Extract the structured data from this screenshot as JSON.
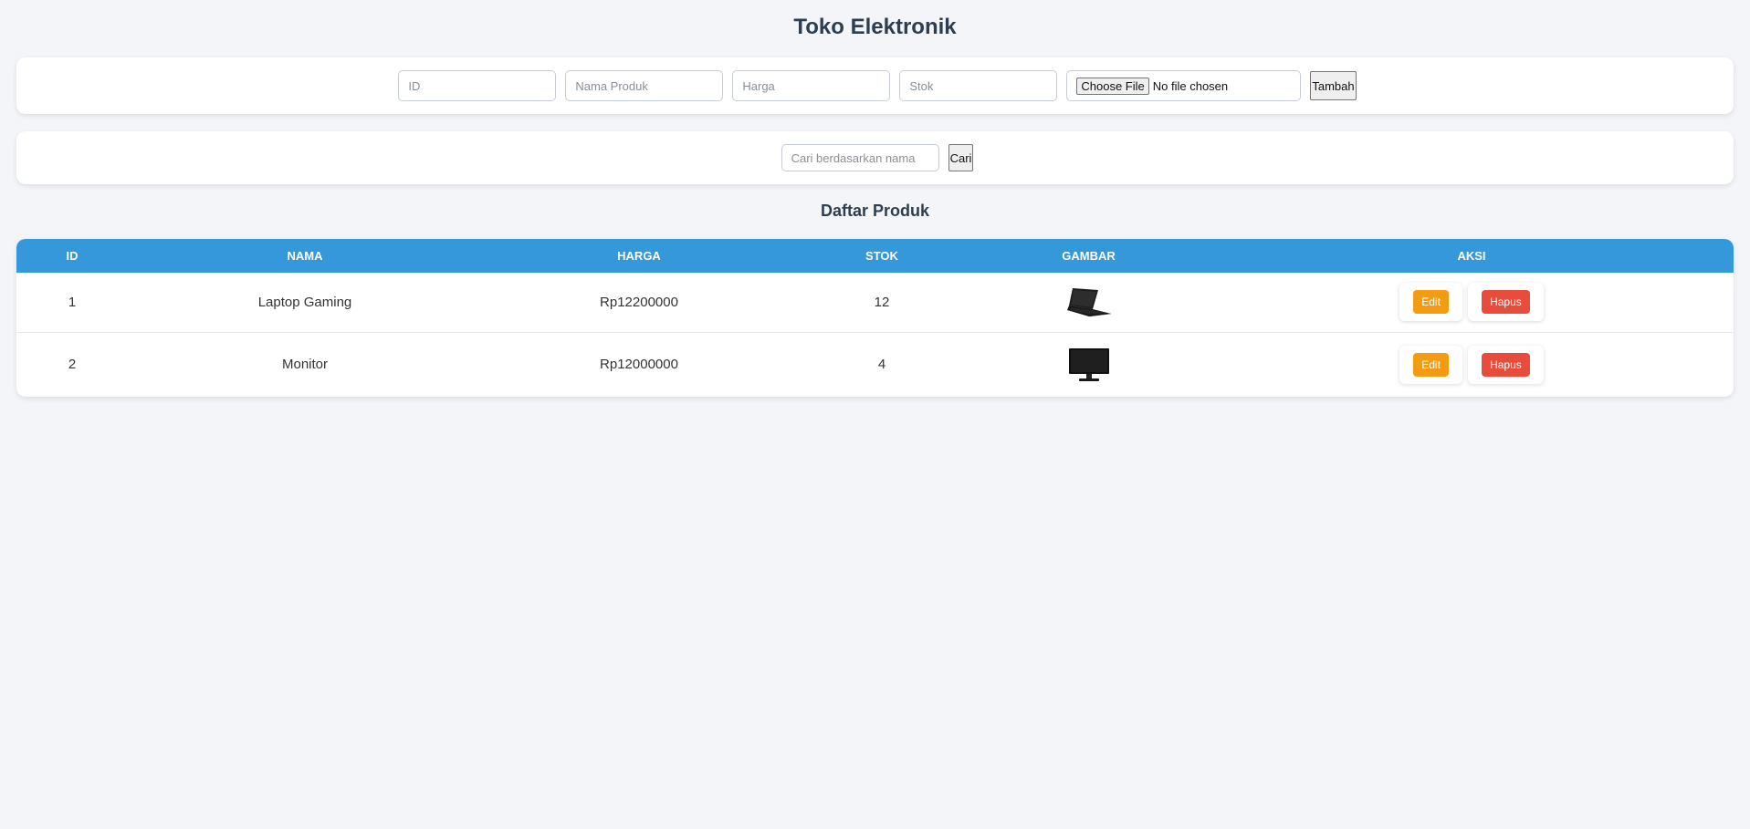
{
  "page": {
    "title": "Toko Elektronik"
  },
  "form": {
    "id_placeholder": "ID",
    "nama_placeholder": "Nama Produk",
    "harga_placeholder": "Harga",
    "stok_placeholder": "Stok",
    "file_button_label": "Choose File",
    "file_status": "No file chosen",
    "submit_label": "Tambah"
  },
  "search": {
    "placeholder": "Cari berdasarkan nama",
    "button_label": "Cari"
  },
  "list": {
    "title": "Daftar Produk",
    "headers": [
      "ID",
      "NAMA",
      "HARGA",
      "STOK",
      "GAMBAR",
      "AKSI"
    ],
    "rows": [
      {
        "id": "1",
        "nama": "Laptop Gaming",
        "harga": "Rp12200000",
        "stok": "12",
        "gambar_icon": "laptop-image",
        "edit_label": "Edit",
        "hapus_label": "Hapus"
      },
      {
        "id": "2",
        "nama": "Monitor",
        "harga": "Rp12000000",
        "stok": "4",
        "gambar_icon": "monitor-image",
        "edit_label": "Edit",
        "hapus_label": "Hapus"
      }
    ]
  },
  "colors": {
    "background": "#f3f5f9",
    "header_blue": "#3498db",
    "edit_orange": "#f39c12",
    "hapus_red": "#e74c3c",
    "title_text": "#2c3e50"
  }
}
